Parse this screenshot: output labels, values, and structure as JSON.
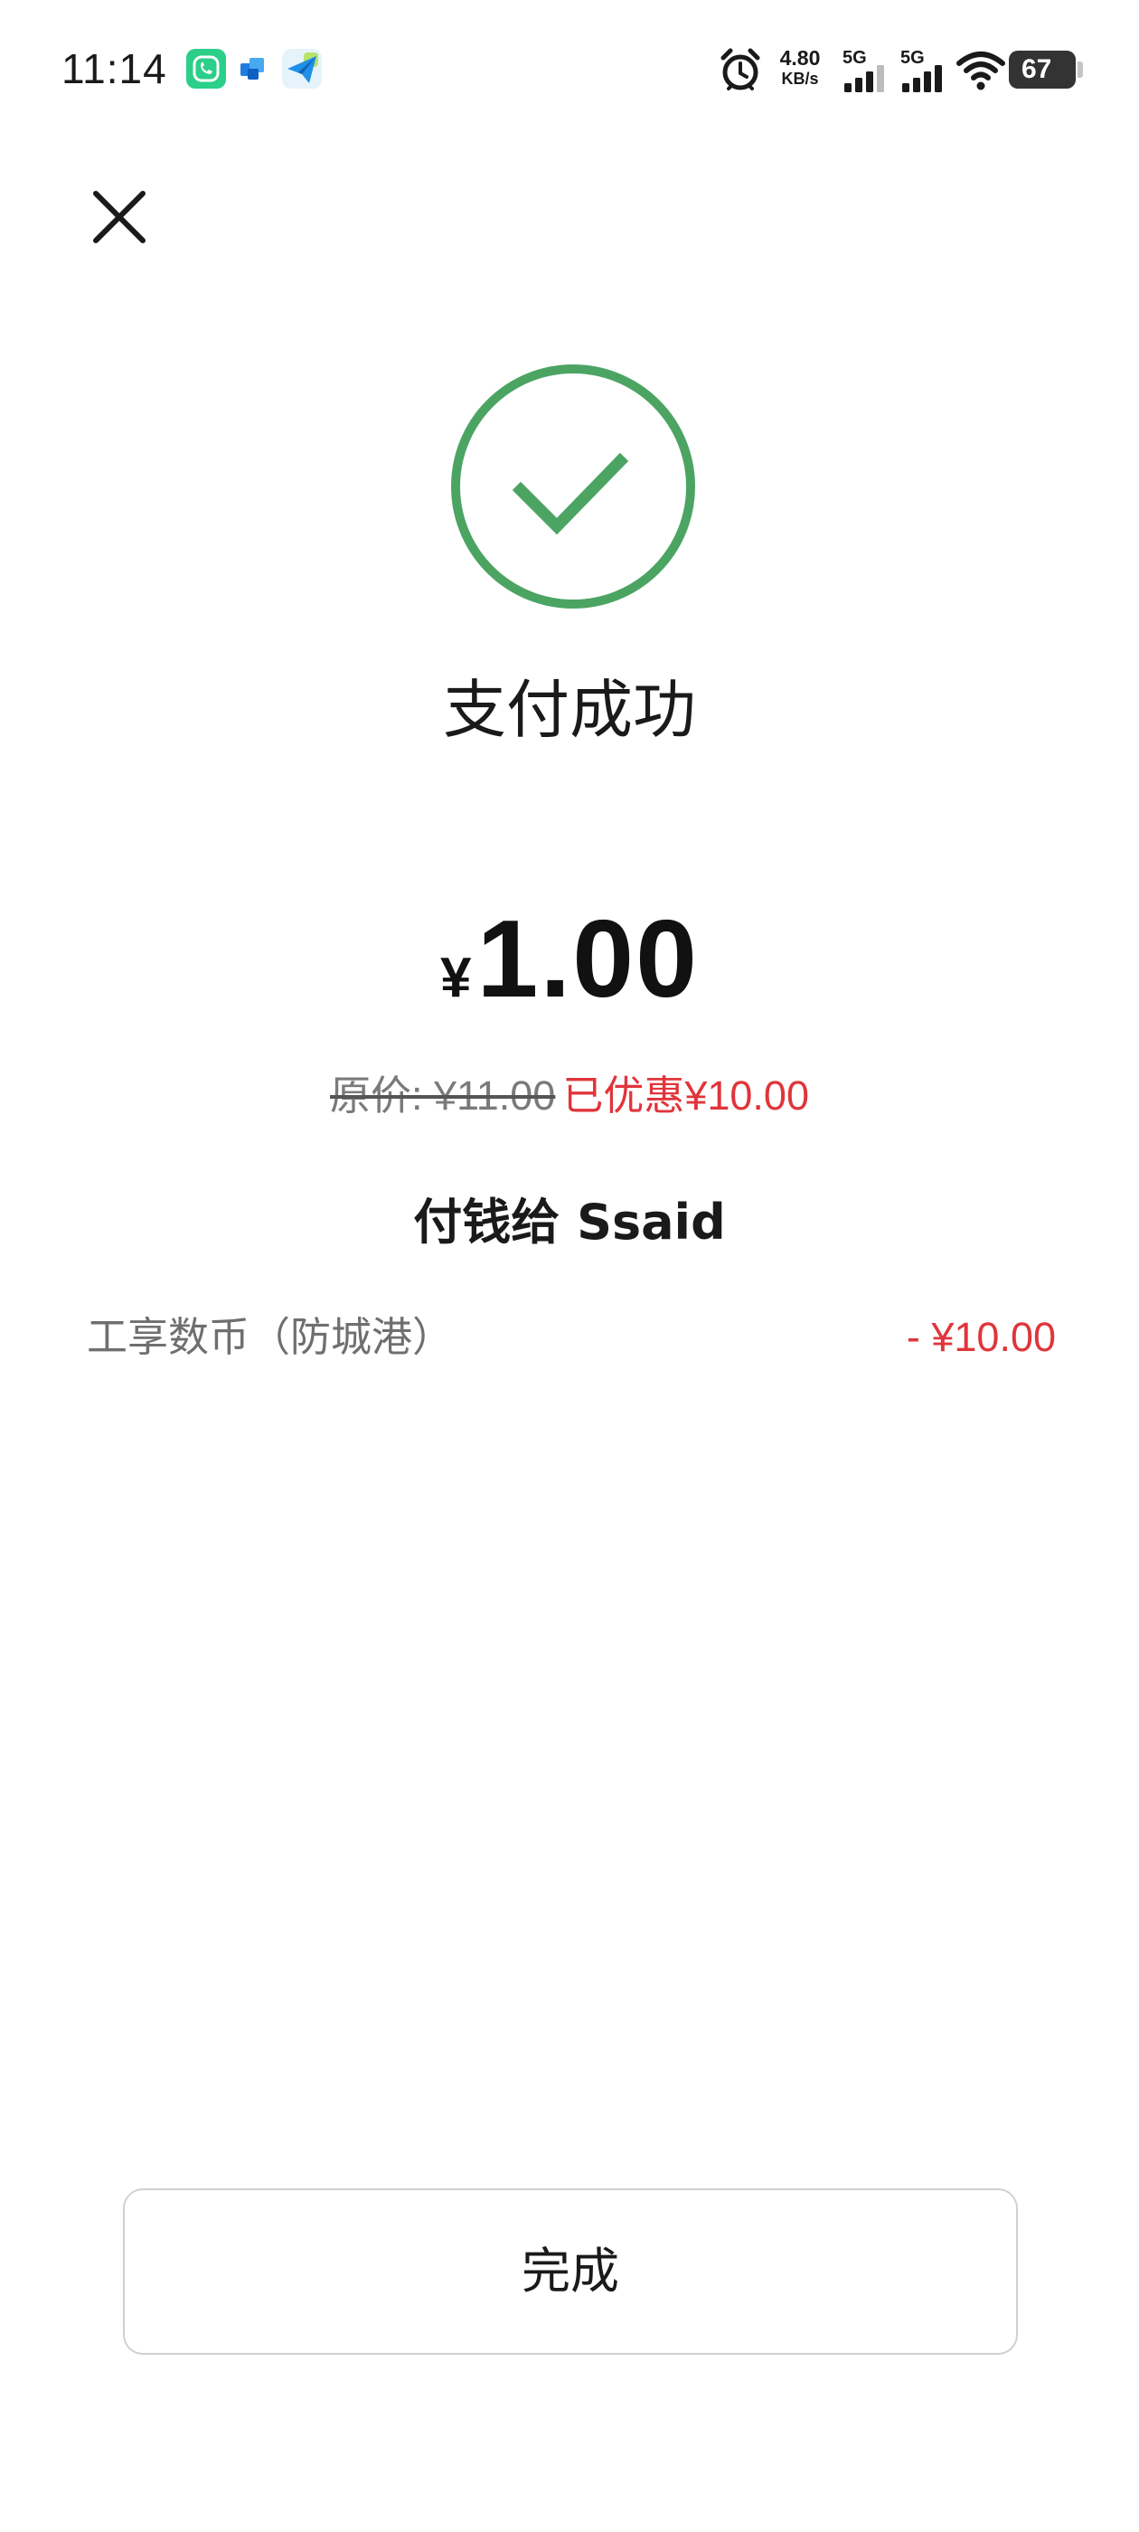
{
  "status_bar": {
    "time": "11:14",
    "network_speed": "4.80",
    "network_speed_unit": "KB/s",
    "sim1_label": "5G",
    "sim2_label": "5G",
    "battery_level": "67",
    "notification_icons": [
      "phone-app-icon",
      "blue-squares-app-icon",
      "send-arrow-app-icon"
    ],
    "status_icons": [
      "alarm-icon",
      "signal-icon",
      "signal-icon",
      "wifi-icon",
      "battery-icon"
    ]
  },
  "header": {
    "close_icon": "close-icon"
  },
  "result": {
    "status_icon": "check-circle-icon",
    "status_color": "#4CA463",
    "title": "支付成功",
    "currency_symbol": "¥",
    "amount": "1.00",
    "original_price": "原价: ¥11.00",
    "discount_text": "已优惠¥10.00",
    "discount_color": "#E0353B",
    "payee": "付钱给 Ssaid"
  },
  "details": [
    {
      "label": "工享数币（防城港）",
      "value": "- ¥10.00"
    }
  ],
  "footer": {
    "done_label": "完成"
  }
}
